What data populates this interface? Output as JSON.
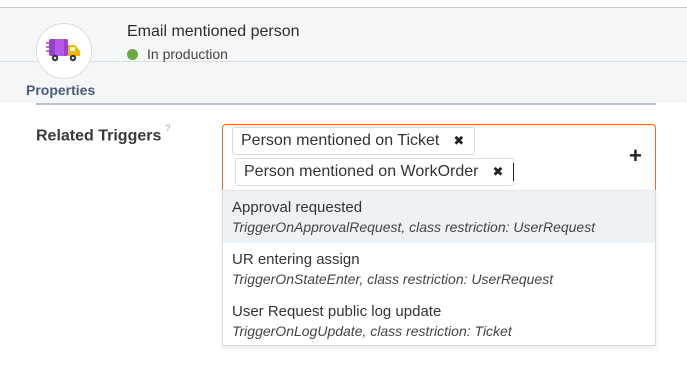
{
  "header": {
    "title": "Email mentioned person",
    "status": "In production",
    "status_color": "#6aaa44",
    "icon": "truck-icon"
  },
  "tabs": [
    {
      "label": "Properties"
    }
  ],
  "field": {
    "label": "Related Triggers",
    "help_marker": "?",
    "selected": [
      {
        "label": "Person mentioned on Ticket",
        "remove_icon": "✖"
      },
      {
        "label": "Person mentioned on WorkOrder",
        "remove_icon": "✖"
      }
    ],
    "add_icon": "+"
  },
  "dropdown": {
    "options": [
      {
        "name": "Approval requested",
        "meta": "TriggerOnApprovalRequest, class restriction: UserRequest"
      },
      {
        "name": "UR entering assign",
        "meta": "TriggerOnStateEnter, class restriction: UserRequest"
      },
      {
        "name": "User Request public log update",
        "meta": "TriggerOnLogUpdate, class restriction: Ticket"
      }
    ]
  },
  "colors": {
    "accent_border": "#e06b2e",
    "tab_text": "#4a5c77",
    "highlight_row": "#edf2f7"
  }
}
